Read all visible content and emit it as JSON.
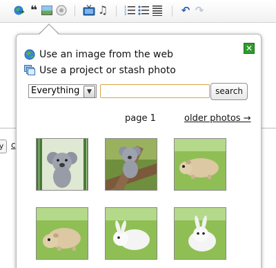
{
  "toolbar": {
    "icons": [
      "insert-link-icon",
      "quote-icon",
      "insert-image-icon",
      "insert-emoticon-icon",
      "insert-video-icon",
      "insert-music-icon",
      "numbered-list-icon",
      "bullet-list-icon",
      "justify-text-icon",
      "undo-icon",
      "redo-icon"
    ]
  },
  "popup": {
    "web_option": "Use an image from the web",
    "project_option": "Use a project or stash photo",
    "filter_selected": "Everything",
    "search_value": "",
    "search_button": "search",
    "page_label": "page 1",
    "older_link": "older photos →",
    "close_icon": "close-icon",
    "photos": [
      {
        "subject": "grey koala amigurumi",
        "bg": "#dfe8d2"
      },
      {
        "subject": "grey koala amigurumi on tree",
        "bg": "#6f8f3f"
      },
      {
        "subject": "beige guinea pig amigurumi",
        "bg": "#8fbf54"
      },
      {
        "subject": "beige guinea pig amigurumi",
        "bg": "#8fbf54"
      },
      {
        "subject": "white bunny amigurumi",
        "bg": "#8fbf54"
      },
      {
        "subject": "white bunny amigurumi",
        "bg": "#8fbf54"
      }
    ]
  },
  "background": {
    "button_label": "y",
    "link_text": "c"
  },
  "colors": {
    "accent_green": "#2e9b2e",
    "input_border": "#d9a441"
  }
}
